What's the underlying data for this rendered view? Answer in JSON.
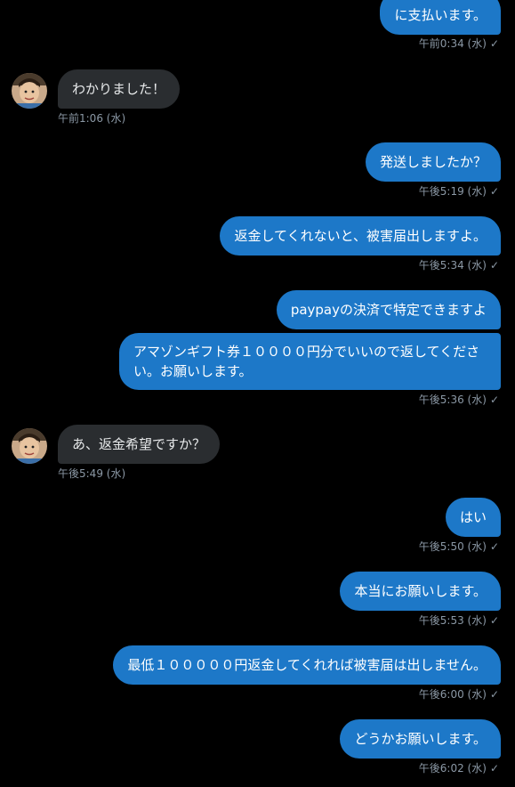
{
  "messages": [
    {
      "dir": "out",
      "text": "に支払います。",
      "time": "午前0:34 (水)"
    },
    {
      "dir": "in",
      "text": "わかりました！",
      "time": "午前1:06 (水)"
    },
    {
      "dir": "out",
      "text": "発送しましたか？",
      "time": "午後5:19 (水)"
    },
    {
      "dir": "out",
      "text": "返金してくれないと、被害届出しますよ。",
      "time": "午後5:34 (水)"
    },
    {
      "dir": "out",
      "text": "paypayの決済で特定できますよ",
      "time": ""
    },
    {
      "dir": "out",
      "text": "アマゾンギフト券１００００円分でいいので返してください。お願いします。",
      "time": "午後5:36 (水)"
    },
    {
      "dir": "in",
      "text": "あ、返金希望ですか？",
      "time": "午後5:49 (水)"
    },
    {
      "dir": "out",
      "text": "はい",
      "time": "午後5:50 (水)"
    },
    {
      "dir": "out",
      "text": "本当にお願いします。",
      "time": "午後5:53 (水)"
    },
    {
      "dir": "out",
      "text": "最低１０００００円返金してくれれば被害届は出しません。",
      "time": "午後6:00 (水)"
    },
    {
      "dir": "out",
      "text": "どうかお願いします。",
      "time": "午後6:02 (水)"
    }
  ],
  "read_mark": "✓",
  "colors": {
    "outgoing": "#1d78c8",
    "incoming": "#2a2d30",
    "background": "#000000",
    "meta": "#8b98a5"
  }
}
